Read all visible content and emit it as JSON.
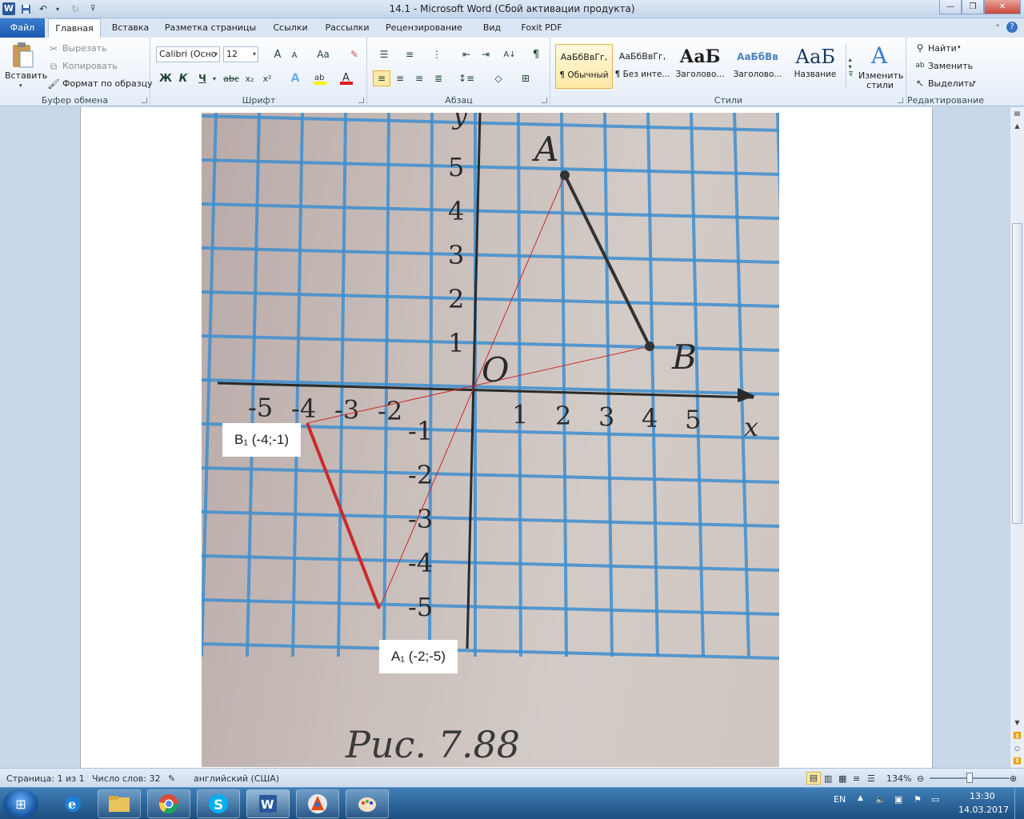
{
  "window": {
    "title": "14.1  -  Microsoft Word (Сбой активации продукта)",
    "qat_icons": [
      "word-logo-icon",
      "save-icon",
      "undo-icon",
      "redo-icon",
      "customize-qat-icon"
    ]
  },
  "tabs": {
    "file": "Файл",
    "items": [
      "Главная",
      "Вставка",
      "Разметка страницы",
      "Ссылки",
      "Рассылки",
      "Рецензирование",
      "Вид",
      "Foxit PDF"
    ],
    "active": "Главная"
  },
  "ribbon": {
    "clipboard": {
      "paste": "Вставить",
      "cut": "Вырезать",
      "copy": "Копировать",
      "format_painter": "Формат по образцу",
      "label": "Буфер обмена"
    },
    "font": {
      "family": "Calibri (Осно",
      "size": "12",
      "bold": "Ж",
      "italic": "К",
      "underline": "Ч",
      "strike": "abc",
      "subscript": "x₂",
      "superscript": "x²",
      "grow": "A",
      "shrink": "A",
      "case": "Aa",
      "label": "Шрифт"
    },
    "paragraph": {
      "label": "Абзац"
    },
    "styles": {
      "items": [
        {
          "sample": "АаБбВвГг,",
          "name": "¶ Обычный",
          "selected": true
        },
        {
          "sample": "АаБбВвГг,",
          "name": "¶ Без инте...",
          "selected": false
        },
        {
          "sample": "АаБ",
          "name": "Заголово...",
          "selected": false
        },
        {
          "sample": "АаБбВв",
          "name": "Заголово...",
          "selected": false
        },
        {
          "sample": "АаБ",
          "name": "Название",
          "selected": false
        }
      ],
      "change_styles": "Изменить стили",
      "label": "Стили"
    },
    "editing": {
      "find": "Найти",
      "replace": "Заменить",
      "select": "Выделить",
      "label": "Редактирование"
    }
  },
  "document": {
    "figure": {
      "x_ticks": [
        "-5",
        "-4",
        "-3",
        "-2",
        "1",
        "2",
        "3",
        "4",
        "5"
      ],
      "y_ticks": [
        "5",
        "4",
        "3",
        "2",
        "1",
        "-1",
        "-2",
        "-3",
        "-4",
        "-5"
      ],
      "x_axis": "x",
      "y_axis": "y",
      "origin": "O",
      "point_a": "A",
      "point_b": "B",
      "caption": "Рис. 7.88",
      "label_b1": "B₁ (-4;-1)",
      "label_a1": "A₁ (-2;-5)",
      "colors": {
        "paper": "#cfc6c1",
        "grid": "#3f8fd0",
        "segment": "#333333",
        "reflected": "#cc2a2a"
      }
    }
  },
  "status": {
    "page": "Страница: 1 из 1",
    "words": "Число слов: 32",
    "language": "английский (США)",
    "zoom": "134%"
  },
  "taskbar": {
    "apps": [
      "internet-explorer-icon",
      "file-explorer-icon",
      "chrome-icon",
      "skype-icon",
      "word-icon",
      "vlc-icon",
      "paint-icon"
    ],
    "lang": "EN",
    "time": "13:30",
    "date": "14.03.2017"
  }
}
